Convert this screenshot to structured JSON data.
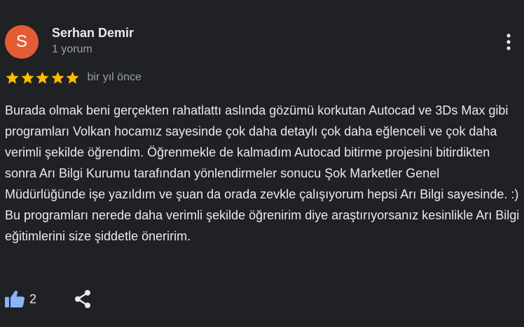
{
  "review": {
    "author": {
      "initial": "S",
      "name": "Serhan Demir",
      "review_count": "1 yorum",
      "avatar_color": "#e25d33"
    },
    "rating": 5,
    "rating_max": 5,
    "date": "bir yıl önce",
    "text": "Burada olmak beni gerçekten rahatlattı aslında gözümü korkutan Autocad ve 3Ds Max gibi programları Volkan hocamız sayesinde çok daha detaylı çok daha eğlenceli ve çok daha verimli şekilde öğrendim. Öğrenmekle de kalmadım Autocad bitirme projesini bitirdikten sonra Arı Bilgi Kurumu tarafından yönlendirmeler sonucu Şok Marketler Genel Müdürlüğünde işe yazıldım ve şuan da orada zevkle çalışıyorum hepsi Arı Bilgi sayesinde. :) Bu programları nerede daha verimli şekilde öğrenirim diye araştırıyorsanız kesinlikle Arı Bilgi eğitimlerini size şiddetle öneririm.",
    "actions": {
      "like_icon": "thumbs-up-icon",
      "like_count": "2",
      "share_icon": "share-icon",
      "more_icon": "more-vert-icon"
    }
  },
  "colors": {
    "background": "#202124",
    "primary_text": "#e8eaed",
    "secondary_text": "#9aa0a6",
    "star": "#fbbc04",
    "like_icon": "#8ab4f8",
    "icon": "#e8eaed"
  }
}
